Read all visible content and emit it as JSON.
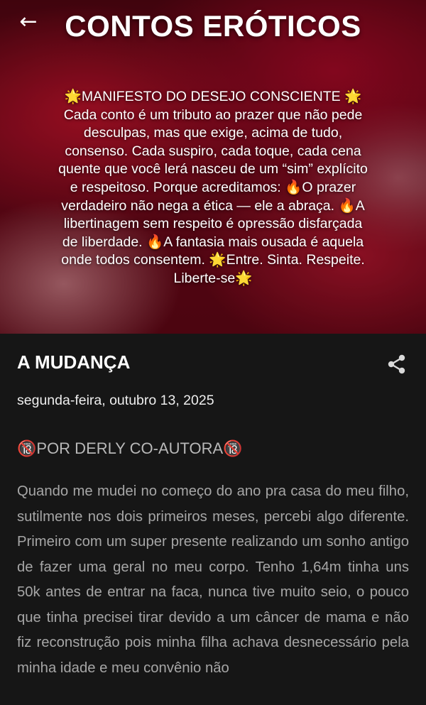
{
  "header": {
    "back_icon": "arrow-left-icon",
    "back_glyph": "←",
    "title": "CONTOS ERÓTICOS",
    "manifesto": "🌟MANIFESTO DO DESEJO CONSCIENTE 🌟 Cada conto é um tributo ao prazer que não pede desculpas, mas que exige, acima de tudo, consenso. Cada suspiro, cada toque, cada cena quente que você lerá nasceu de um “sim” explícito e respeitoso. Porque acreditamos: 🔥O prazer verdadeiro não nega a ética — ele a abraça. 🔥A libertinagem sem respeito é opressão disfarçada de liberdade. 🔥A fantasia mais ousada é aquela onde todos consentem. 🌟Entre. Sinta. Respeite. Liberte-se🌟"
  },
  "post": {
    "title": "A MUDANÇA",
    "share_icon": "share-icon",
    "date": "segunda-feira, outubro 13, 2025",
    "byline": "🔞POR DERLY CO-AUTORA🔞",
    "body": "Quando me mudei no começo do ano pra casa do meu filho, sutilmente nos dois primeiros meses, percebi algo diferente. Primeiro com um super presente realizando um sonho antigo de fazer uma geral no meu corpo. Tenho 1,64m tinha uns 50k antes de entrar na faca, nunca tive muito seio, o pouco que tinha precisei tirar devido a um câncer de mama e não fiz reconstrução pois minha filha achava desnecessário pela minha idade e meu convênio não"
  },
  "colors": {
    "background": "#161616",
    "accent_red": "#8a0c1f",
    "title_text": "#ffffff",
    "body_text": "#a6a6a6"
  }
}
